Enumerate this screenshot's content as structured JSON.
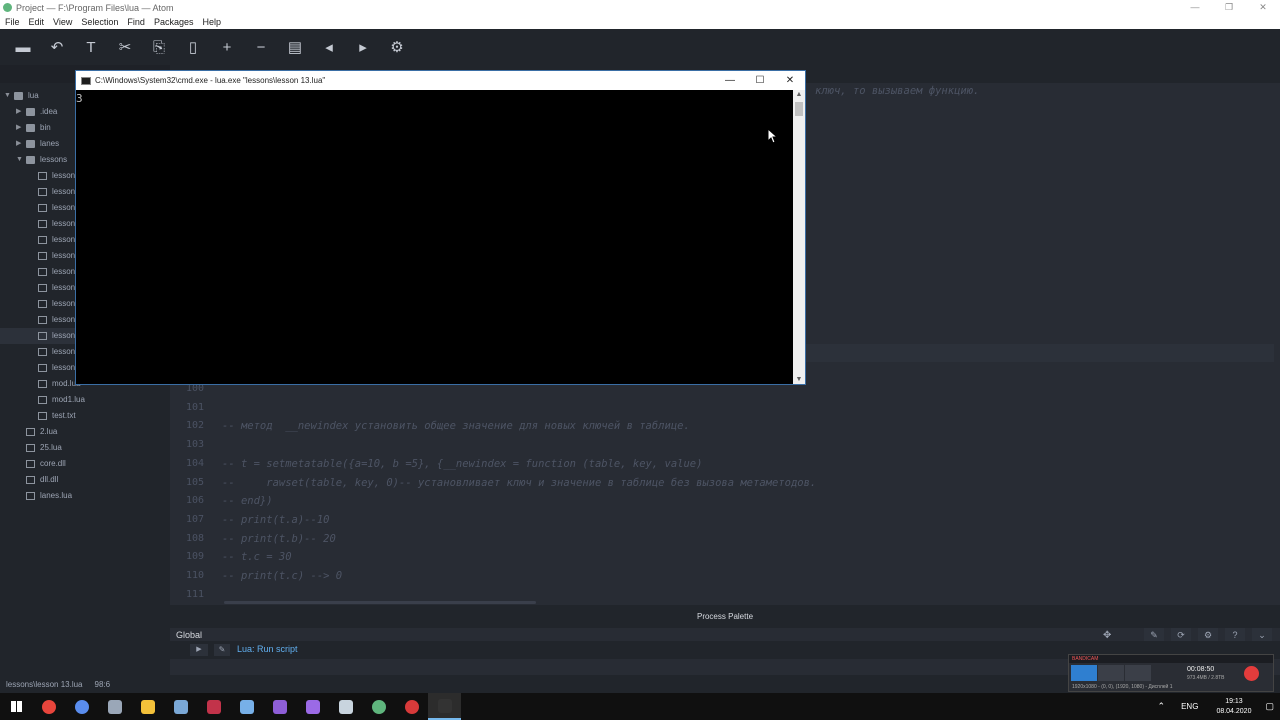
{
  "window": {
    "title": "Project — F:\\Program Files\\lua — Atom",
    "controls": [
      "—",
      "❐",
      "✕"
    ]
  },
  "menu": [
    "File",
    "Edit",
    "View",
    "Selection",
    "Find",
    "Packages",
    "Help"
  ],
  "toolbar": {
    "icons": [
      "folder-icon",
      "undo-icon",
      "format-icon",
      "tools-icon",
      "copy-icon",
      "bookmark-icon",
      "plus-icon",
      "minus-icon",
      "file-icon",
      "left-icon",
      "right-icon",
      "gear-icon"
    ],
    "glyphs": [
      "▬",
      "↶",
      "T",
      "✂",
      "⎘",
      "▯",
      "+",
      "−",
      "▤",
      "◂",
      "▸",
      "⚙"
    ]
  },
  "tree": {
    "root": "lua",
    "items": [
      {
        "label": ".idea",
        "type": "folder",
        "depth": 1,
        "expanded": false
      },
      {
        "label": "bin",
        "type": "folder",
        "depth": 1,
        "expanded": false
      },
      {
        "label": "lanes",
        "type": "folder",
        "depth": 1,
        "expanded": false
      },
      {
        "label": "lessons",
        "type": "folder",
        "depth": 1,
        "expanded": true
      },
      {
        "label": "lesson",
        "type": "file",
        "depth": 2
      },
      {
        "label": "lesson",
        "type": "file",
        "depth": 2
      },
      {
        "label": "lesson",
        "type": "file",
        "depth": 2
      },
      {
        "label": "lesson",
        "type": "file",
        "depth": 2
      },
      {
        "label": "lesson",
        "type": "file",
        "depth": 2
      },
      {
        "label": "lesson",
        "type": "file",
        "depth": 2
      },
      {
        "label": "lesson",
        "type": "file",
        "depth": 2
      },
      {
        "label": "lesson",
        "type": "file",
        "depth": 2
      },
      {
        "label": "lesson",
        "type": "file",
        "depth": 2
      },
      {
        "label": "lesson",
        "type": "file",
        "depth": 2
      },
      {
        "label": "lesson",
        "type": "file",
        "depth": 2,
        "selected": true
      },
      {
        "label": "lesson",
        "type": "file",
        "depth": 2
      },
      {
        "label": "lesson",
        "type": "file",
        "depth": 2
      },
      {
        "label": "mod.lua",
        "type": "file",
        "depth": 2
      },
      {
        "label": "mod1.lua",
        "type": "file",
        "depth": 2
      },
      {
        "label": "test.txt",
        "type": "file",
        "depth": 2
      },
      {
        "label": "2.lua",
        "type": "file",
        "depth": 1
      },
      {
        "label": "25.lua",
        "type": "file",
        "depth": 1
      },
      {
        "label": "core.dll",
        "type": "file",
        "depth": 1
      },
      {
        "label": "dll.dll",
        "type": "file",
        "depth": 1
      },
      {
        "label": "lanes.lua",
        "type": "file",
        "depth": 1
      }
    ]
  },
  "editor": {
    "top_fragment": "ключ, то вызываем функцию.",
    "lines": [
      {
        "num": "100",
        "text": ""
      },
      {
        "num": "101",
        "text": ""
      },
      {
        "num": "102",
        "text": "-- метод  __newindex установить общее значение для новых ключей в таблице."
      },
      {
        "num": "103",
        "text": ""
      },
      {
        "num": "104",
        "text": "-- t = setmetatable({a=10, b =5}, {__newindex = function (table, key, value)"
      },
      {
        "num": "105",
        "text": "--     rawset(table, key, 0)-- установливает ключ и значение в таблице без вызова метаметодов."
      },
      {
        "num": "106",
        "text": "-- end})"
      },
      {
        "num": "107",
        "text": "-- print(t.a)--10"
      },
      {
        "num": "108",
        "text": "-- print(t.b)-- 20"
      },
      {
        "num": "109",
        "text": "-- t.c = 30"
      },
      {
        "num": "110",
        "text": "-- print(t.c) --> 0"
      },
      {
        "num": "111",
        "text": ""
      }
    ]
  },
  "cmd": {
    "title": "C:\\Windows\\System32\\cmd.exe - lua.exe  \"lessons\\lesson 13.lua\"",
    "output": "3",
    "controls": [
      "—",
      "☐",
      "✕"
    ]
  },
  "palette": {
    "header": "Process Palette",
    "scope": "Global",
    "script_label": "Lua: Run script",
    "actions": [
      "✎",
      "⟳",
      "⚙",
      "?",
      "⌄"
    ]
  },
  "status": {
    "file": "lessons\\lesson 13.lua",
    "position": "98:6"
  },
  "bandicam": {
    "brand": "BANDICAM",
    "time": "00:08:50",
    "size": "973.4MB / 2.8TB",
    "info": "1920x1080 - (0, 0), (1920, 1080) - Дисплей 1"
  },
  "taskbar": {
    "apps": [
      {
        "name": "chrome",
        "color": "#e8453c"
      },
      {
        "name": "app-circle",
        "color": "#5a8dee"
      },
      {
        "name": "app-files",
        "color": "#9aa7b8"
      },
      {
        "name": "explorer",
        "color": "#f3c13a"
      },
      {
        "name": "app-cube",
        "color": "#7aa8d6"
      },
      {
        "name": "app-grid",
        "color": "#c2334a"
      },
      {
        "name": "app-gear",
        "color": "#77b0e8"
      },
      {
        "name": "visual-studio",
        "color": "#8e5ed8"
      },
      {
        "name": "visual-studio-2",
        "color": "#9b6ae6"
      },
      {
        "name": "app-leaf",
        "color": "#c8d4de"
      },
      {
        "name": "atom",
        "color": "#5fb57d"
      },
      {
        "name": "bandicam",
        "color": "#d83a3a"
      },
      {
        "name": "cmd",
        "color": "#333333",
        "active": true
      }
    ],
    "lang": "ENG",
    "time": "19:13",
    "date": "08.04.2020"
  }
}
